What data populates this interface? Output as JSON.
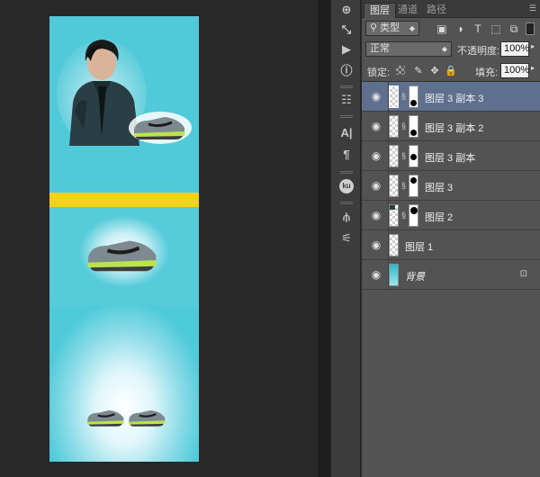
{
  "panel": {
    "tabs": [
      {
        "label": "图层",
        "active": true
      },
      {
        "label": "通道",
        "active": false
      },
      {
        "label": "路径",
        "active": false
      }
    ],
    "filter": {
      "label": "类型"
    },
    "blend_mode": "正常",
    "opacity": {
      "label": "不透明度:",
      "value": "100%"
    },
    "lock": {
      "label": "锁定:"
    },
    "fill": {
      "label": "填充:",
      "value": "100%"
    }
  },
  "layers": [
    {
      "name": "图层 3 副本 3",
      "selected": true
    },
    {
      "name": "图层 3 副本 2",
      "selected": false
    },
    {
      "name": "图层 3 副本",
      "selected": false
    },
    {
      "name": "图层 3",
      "selected": false
    },
    {
      "name": "图层 2",
      "selected": false
    },
    {
      "name": "图层 1",
      "selected": false
    },
    {
      "name": "背景",
      "selected": false,
      "locked": true
    }
  ],
  "colors": {
    "panel_bg": "#535353",
    "selected_layer": "#5f6f8e",
    "canvas_cyan": "#50c9d8",
    "yellow_band": "#f3d21a"
  },
  "icons": [
    "search-icon",
    "pixel-filter-icon",
    "adjustment-filter-icon",
    "type-filter-icon",
    "shape-filter-icon",
    "smart-filter-icon",
    "eye-icon",
    "link-icon",
    "lock-icon"
  ]
}
